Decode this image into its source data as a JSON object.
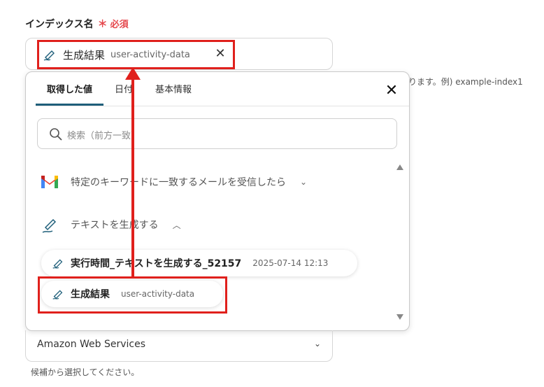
{
  "field": {
    "label": "インデックス名",
    "required_star": "＊",
    "required_text": "必須",
    "hint_right": "ります。例) example-index1"
  },
  "selected_chip": {
    "title": "生成結果",
    "value": "user-activity-data",
    "icon": "pen-icon",
    "close_icon": "close-icon"
  },
  "popup": {
    "tabs": [
      "取得した値",
      "日付",
      "基本情報"
    ],
    "active_tab": "取得した値",
    "search_placeholder": "検索（前方一致）",
    "groups": [
      {
        "label": "特定のキーワードに一致するメールを受信したら",
        "icon": "gmail-icon",
        "expanded": false
      },
      {
        "label": "テキストを生成する",
        "icon": "pen-icon",
        "expanded": true
      }
    ],
    "items": [
      {
        "title": "実行時間_テキストを生成する_52157",
        "meta": "2025-07-14 12:13",
        "icon": "pen-icon"
      },
      {
        "title": "生成結果",
        "meta": "user-activity-data",
        "icon": "pen-icon"
      }
    ]
  },
  "select": {
    "value": "Amazon Web Services",
    "hint": "候補から選択してください。"
  },
  "colors": {
    "accent": "#1f5f7a",
    "highlight": "#e0201c",
    "required": "#e5484d"
  }
}
